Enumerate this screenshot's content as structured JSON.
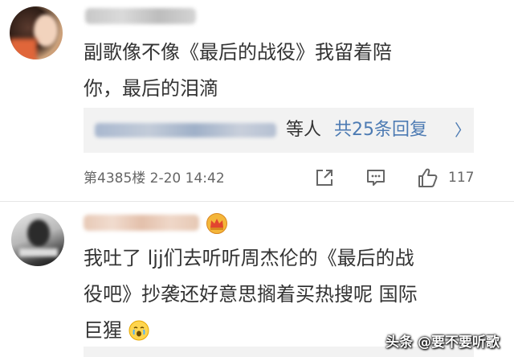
{
  "comments": [
    {
      "text_line1": "副歌像不像《最后的战役》我留着陪",
      "text_line2": "你，最后的泪滴",
      "reply": {
        "suffix": "等人",
        "link": "共25条回复",
        "arrow": "〉"
      },
      "meta": "第4385楼  2-20 14:42",
      "likes": "117"
    },
    {
      "text_line1": "我吐了 ljj们去听听周杰伦的《最后的战",
      "text_line2": "役吧》抄袭还好意思搁着买热搜呢 国际",
      "text_line3": "巨猩"
    }
  ],
  "watermark": "头条 @要不要听歌",
  "colors": {
    "text": "#333333",
    "meta": "#666666",
    "link_blue": "#4d7bb3",
    "reply_bg": "#f2f2f2"
  },
  "icons": [
    "share-icon",
    "comment-icon",
    "like-icon",
    "crown-icon",
    "crying-emoji-icon"
  ]
}
